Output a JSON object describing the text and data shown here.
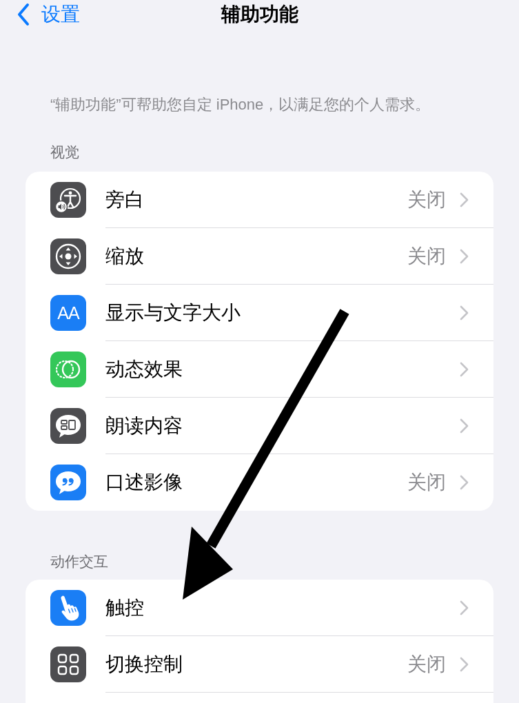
{
  "nav": {
    "back_label": "设置",
    "title": "辅助功能"
  },
  "description": "“辅助功能”可帮助您自定 iPhone，以满足您的个人需求。",
  "sections": [
    {
      "header": "视觉",
      "cut_off": false,
      "rows": [
        {
          "label": "旁白",
          "value": "关闭"
        },
        {
          "label": "缩放",
          "value": "关闭"
        },
        {
          "label": "显示与文字大小",
          "icon_text": "AA"
        },
        {
          "label": "动态效果"
        },
        {
          "label": "朗读内容"
        },
        {
          "label": "口述影像",
          "value": "关闭"
        }
      ]
    },
    {
      "header": "动作交互",
      "cut_off": true,
      "rows": [
        {
          "label": "触控"
        },
        {
          "label": "切换控制",
          "value": "关闭"
        }
      ]
    }
  ]
}
